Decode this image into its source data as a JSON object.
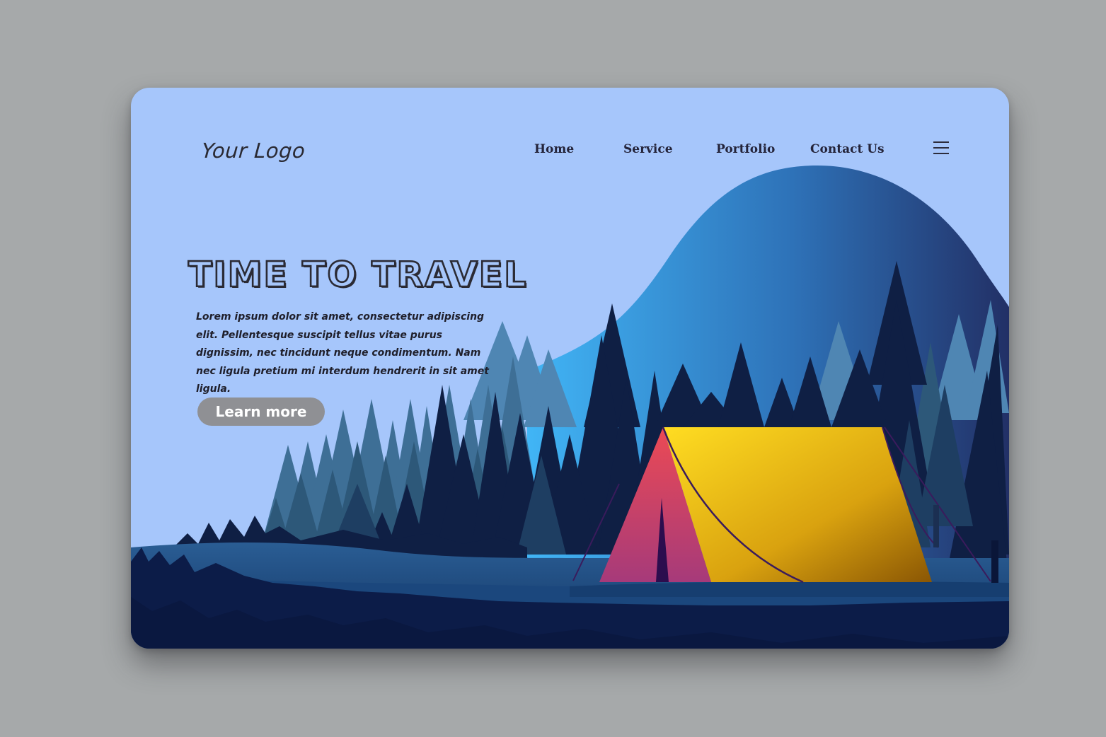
{
  "header": {
    "logo": "Your Logo",
    "nav": [
      {
        "label": "Home"
      },
      {
        "label": "Service"
      },
      {
        "label": "Portfolio"
      },
      {
        "label": "Contact Us"
      }
    ],
    "menu_icon": "hamburger-icon"
  },
  "hero": {
    "title": "TIME TO TRAVEL",
    "description": "Lorem ipsum dolor sit amet, consectetur adipiscing elit. Pellentesque suscipit tellus vitae purus dignissim, nec tincidunt neque condimentum. Nam nec ligula pretium mi interdum hendrerit in sit amet ligula.",
    "cta": "Learn more"
  },
  "colors": {
    "sky": "#a6c6fb",
    "page_background": "#a6a9aa",
    "button": "#8f9094",
    "tent_yellow": "#f4c21a",
    "tent_red": "#d6405e",
    "forest_dark": "#0b1a3a",
    "forest_mid": "#1e3e62"
  }
}
